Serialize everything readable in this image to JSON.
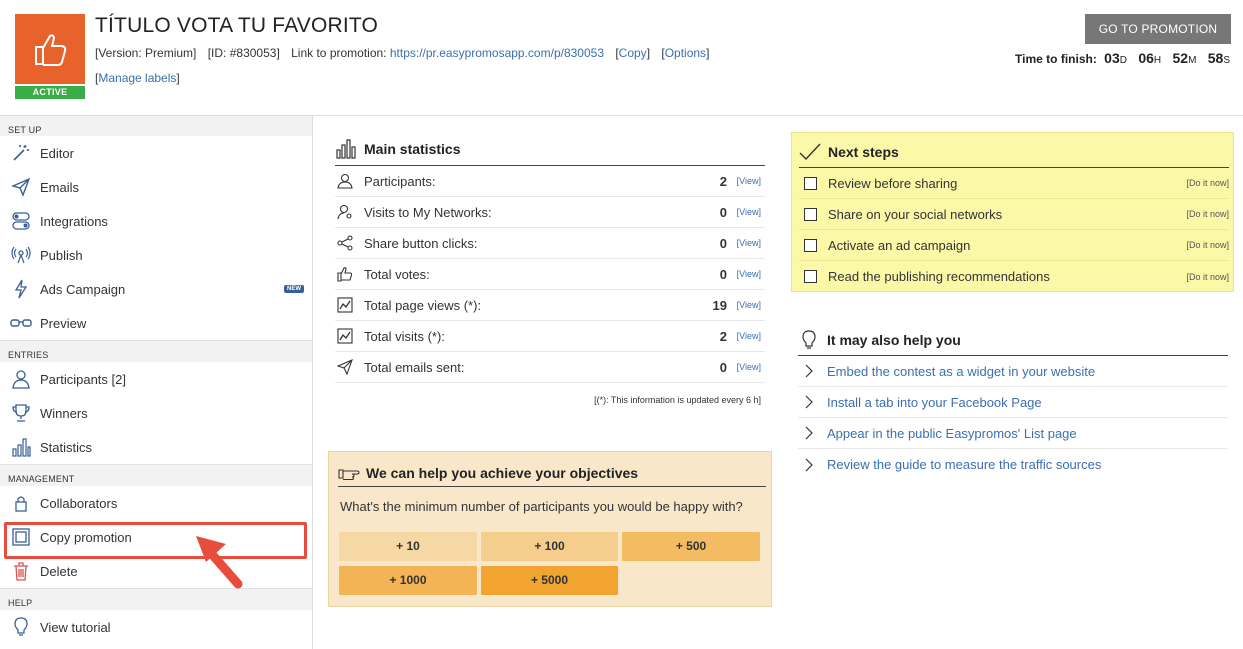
{
  "header": {
    "status_badge": "ACTIVE",
    "title": "TÍTULO VOTA TU FAVORITO",
    "version": "[Version: Premium]",
    "id": "[ID: #830053]",
    "link_label": "Link to promotion:",
    "link_url": "https://pr.easypromosapp.com/p/830053",
    "copy_link": "Copy",
    "options_link": "Options",
    "manage_labels": "Manage labels",
    "go_button": "GO TO PROMOTION",
    "countdown": {
      "label": "Time to finish:",
      "days": "03",
      "days_unit": "D",
      "hours": "06",
      "hours_unit": "H",
      "minutes": "52",
      "minutes_unit": "M",
      "seconds": "58",
      "seconds_unit": "S"
    }
  },
  "sidebar": {
    "sections": [
      {
        "title": "SET UP",
        "items": [
          {
            "label": "Editor",
            "icon": "magic-wand-icon"
          },
          {
            "label": "Emails",
            "icon": "paper-plane-icon"
          },
          {
            "label": "Integrations",
            "icon": "toggles-icon"
          },
          {
            "label": "Publish",
            "icon": "broadcast-icon"
          },
          {
            "label": "Ads Campaign",
            "icon": "lightning-icon",
            "badge": "NEW"
          },
          {
            "label": "Preview",
            "icon": "glasses-icon"
          }
        ]
      },
      {
        "title": "ENTRIES",
        "items": [
          {
            "label": "Participants [2]",
            "icon": "user-icon"
          },
          {
            "label": "Winners",
            "icon": "trophy-icon"
          },
          {
            "label": "Statistics",
            "icon": "bar-chart-icon"
          }
        ]
      },
      {
        "title": "MANAGEMENT",
        "items": [
          {
            "label": "Collaborators",
            "icon": "lock-icon"
          },
          {
            "label": "Copy promotion",
            "icon": "copy-icon"
          },
          {
            "label": "Delete",
            "icon": "trash-icon"
          }
        ]
      },
      {
        "title": "HELP",
        "items": [
          {
            "label": "View tutorial",
            "icon": "lightbulb-icon"
          }
        ]
      }
    ]
  },
  "stats": {
    "title": "Main statistics",
    "view_label": "[View]",
    "rows": [
      {
        "label": "Participants:",
        "value": "2",
        "icon": "user-icon"
      },
      {
        "label": "Visits to My Networks:",
        "value": "0",
        "icon": "user-search-icon"
      },
      {
        "label": "Share button clicks:",
        "value": "0",
        "icon": "share-icon"
      },
      {
        "label": "Total votes:",
        "value": "0",
        "icon": "thumbs-up-icon"
      },
      {
        "label": "Total page views (*):",
        "value": "19",
        "icon": "line-chart-icon"
      },
      {
        "label": "Total visits (*):",
        "value": "2",
        "icon": "line-chart-icon"
      },
      {
        "label": "Total emails sent:",
        "value": "0",
        "icon": "paper-plane-icon"
      }
    ],
    "note": "[(*): This information is updated every 6 h]"
  },
  "objectives": {
    "title": "We can help you achieve your objectives",
    "question": "What's the minimum number of participants you would be happy with?",
    "options": [
      "+ 10",
      "+ 100",
      "+ 500",
      "+ 1000",
      "+ 5000"
    ],
    "colors": [
      "#f6d8a4",
      "#f5cd8c",
      "#f3bb62",
      "#f3b455",
      "#f2a431"
    ]
  },
  "next_steps": {
    "title": "Next steps",
    "do_label": "[Do it now]",
    "items": [
      "Review before sharing",
      "Share on your social networks",
      "Activate an ad campaign",
      "Read the publishing recommendations"
    ]
  },
  "may_help": {
    "title": "It may also help you",
    "links": [
      "Embed the contest as a widget in your website",
      "Install a tab into your Facebook Page",
      "Appear in the public Easypromos' List page",
      "Review the guide to measure the traffic sources"
    ]
  }
}
